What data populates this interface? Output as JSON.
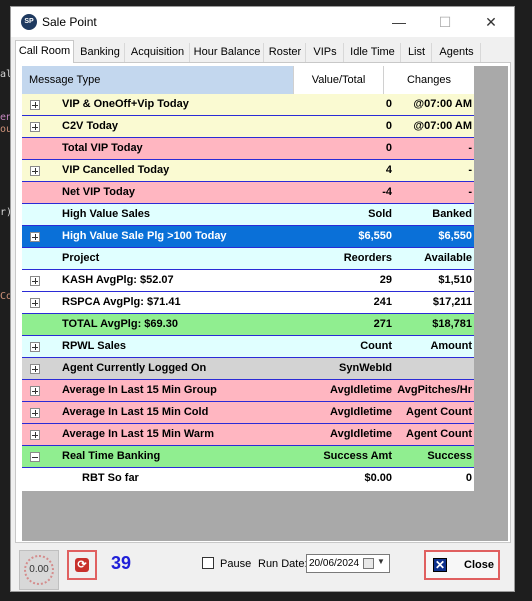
{
  "editor_fragments": [
    {
      "text": "al",
      "color": "#d4d4d4"
    },
    {
      "text": "en",
      "color": "#c586c0"
    },
    {
      "text": "ou",
      "color": "#ce9178"
    },
    {
      "text": "r)",
      "color": "#d4d4d4"
    },
    {
      "text": "Co",
      "color": "#ce9178"
    }
  ],
  "window": {
    "icon_text": "SP",
    "title": "Sale Point",
    "minimize": "—",
    "maximize": "☐",
    "close": "✕"
  },
  "tabs": [
    "Call Room",
    "Banking",
    "Acquisition",
    "Hour Balance",
    "Roster",
    "VIPs",
    "Idle Time",
    "List",
    "Agents"
  ],
  "active_tab": "Call Room",
  "grid": {
    "headers": {
      "name": "Message Type",
      "value": "Value/Total",
      "changes": "Changes"
    },
    "colors": {
      "header_selected": "#c3d7ee",
      "yellow": "#fafad2",
      "pink": "#ffb6c1",
      "cyan": "#e0ffff",
      "blue_selected": "#0a70d8",
      "white": "#ffffff",
      "green": "#90ee90",
      "gray": "#d3d3d3",
      "row_border": "#2b2bd6"
    },
    "rows": [
      {
        "expander": "plus",
        "name": "VIP & OneOff+Vip Today",
        "value": "0",
        "changes": "@07:00 AM",
        "bg": "#fafad2"
      },
      {
        "expander": "plus",
        "name": "C2V Today",
        "value": "0",
        "changes": "@07:00 AM",
        "bg": "#fafad2"
      },
      {
        "expander": "",
        "name": "Total VIP Today",
        "value": "0",
        "changes": "-",
        "bg": "#ffb6c1"
      },
      {
        "expander": "plus",
        "name": "VIP Cancelled Today",
        "value": "4",
        "changes": "-",
        "bg": "#fafad2"
      },
      {
        "expander": "",
        "name": "Net VIP Today",
        "value": "-4",
        "changes": "-",
        "bg": "#ffb6c1"
      },
      {
        "expander": "",
        "name": "High Value Sales",
        "value": "Sold",
        "changes": "Banked",
        "bg": "#e0ffff"
      },
      {
        "expander": "plus",
        "name": "High Value Sale Plg >100 Today",
        "value": "$6,550",
        "changes": "$6,550",
        "bg": "#0a70d8",
        "fg": "#ffffff"
      },
      {
        "expander": "",
        "name": "Project",
        "value": "Reorders",
        "changes": "Available",
        "bg": "#e0ffff"
      },
      {
        "expander": "plus",
        "name": "KASH AvgPlg: $52.07",
        "value": "29",
        "changes": "$1,510",
        "bg": "#ffffff"
      },
      {
        "expander": "plus",
        "name": "RSPCA AvgPlg: $71.41",
        "value": "241",
        "changes": "$17,211",
        "bg": "#ffffff"
      },
      {
        "expander": "",
        "name": "TOTAL AvgPlg: $69.30",
        "value": "271",
        "changes": "$18,781",
        "bg": "#90ee90"
      },
      {
        "expander": "plus",
        "name": "RPWL Sales",
        "value": "Count",
        "changes": "Amount",
        "bg": "#e0ffff"
      },
      {
        "expander": "plus",
        "name": "Agent Currently Logged On",
        "value": "SynWebId",
        "changes": "",
        "bg": "#d3d3d3"
      },
      {
        "expander": "plus",
        "name": "Average In Last 15 Min Group",
        "value": "AvgIdletime",
        "changes": "AvgPitches/Hr",
        "bg": "#ffb6c1"
      },
      {
        "expander": "plus",
        "name": "Average In Last 15 Min Cold",
        "value": "AvgIdletime",
        "changes": "Agent Count",
        "bg": "#ffb6c1"
      },
      {
        "expander": "plus",
        "name": "Average In Last 15 Min Warm",
        "value": "AvgIdletime",
        "changes": "Agent Count",
        "bg": "#ffb6c1"
      },
      {
        "expander": "minus",
        "name": "Real Time Banking",
        "value": "Success Amt",
        "changes": "Success Count",
        "bg": "#90ee90"
      },
      {
        "expander": "",
        "name": "RBT So far",
        "value": "$0.00",
        "changes": "0",
        "bg": "#ffffff",
        "indent": true
      }
    ]
  },
  "bottom": {
    "spinner_value": "0.00",
    "refresh_icon": "refresh-icon",
    "count": "39",
    "pause_label": "Pause",
    "pause_checked": false,
    "run_date_label": "Run Date:",
    "run_date_value": "20/06/2024",
    "close_label": "Close"
  }
}
